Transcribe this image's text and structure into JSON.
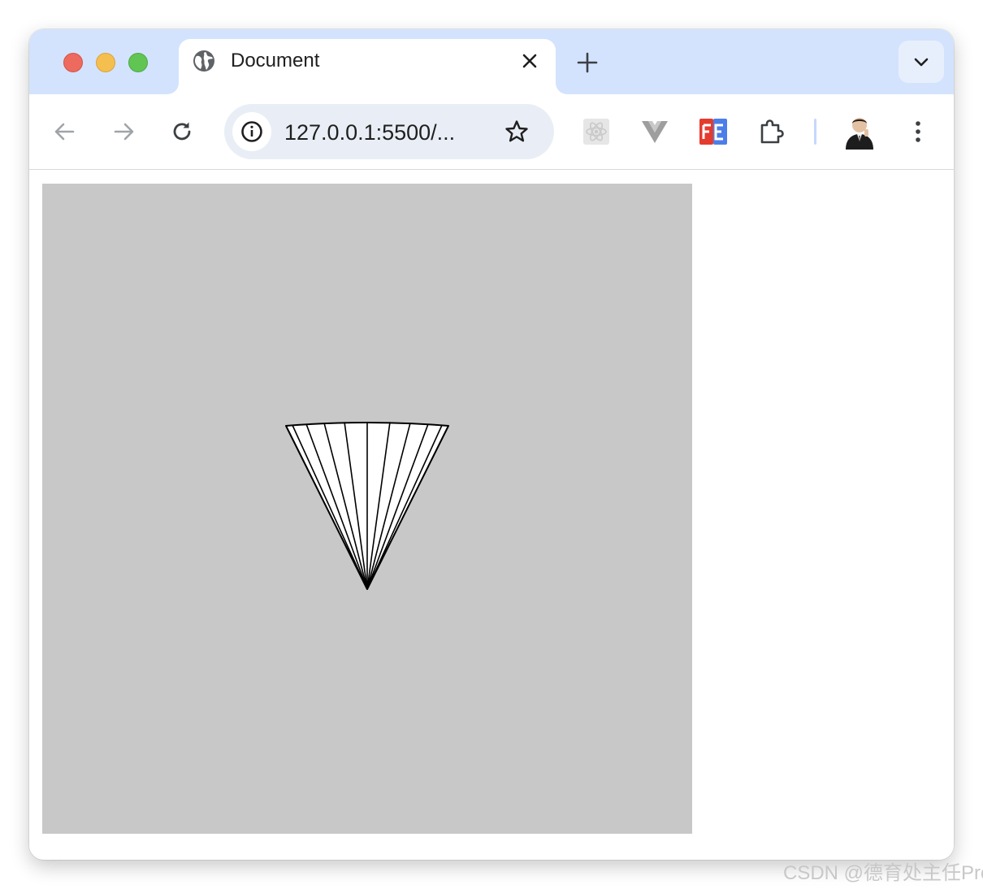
{
  "window": {
    "traffic_lights": [
      "close",
      "minimize",
      "maximize"
    ]
  },
  "tab": {
    "title": "Document",
    "favicon_icon": "globe-icon",
    "close_icon": "close-icon"
  },
  "tabstrip": {
    "new_tab_icon": "plus-icon",
    "tab_search_icon": "chevron-down-icon"
  },
  "toolbar": {
    "back_icon": "arrow-left-icon",
    "forward_icon": "arrow-right-icon",
    "reload_icon": "reload-icon",
    "site_info_icon": "info-icon",
    "url": "127.0.0.1:5500/...",
    "bookmark_icon": "star-icon",
    "extensions": [
      "react-devtools-icon",
      "vue-devtools-icon",
      "fe-helper-icon",
      "extensions-puzzle-icon"
    ],
    "profile_icon": "avatar",
    "menu_icon": "more-vert-icon"
  },
  "page": {
    "canvas_background": "#c8c8c8",
    "figure": "cone-wireframe"
  },
  "watermark": "CSDN @德育处主任Pro"
}
